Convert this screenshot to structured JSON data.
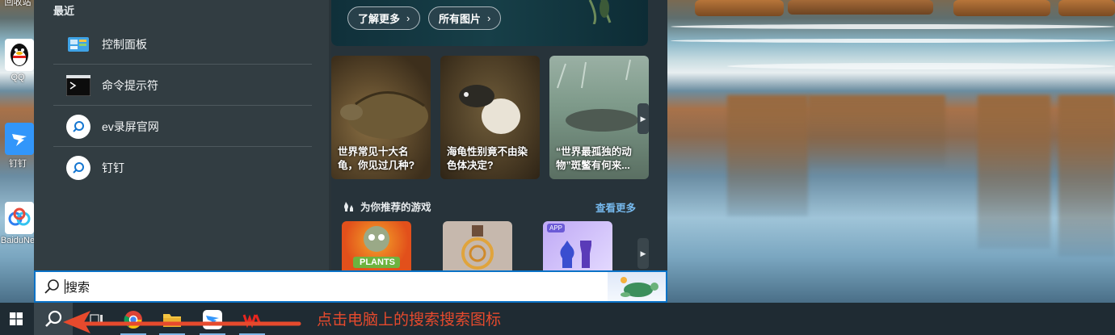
{
  "desktop": {
    "icons": [
      {
        "label": "回收站",
        "icon": "recycle-bin-icon"
      },
      {
        "label": "QQ",
        "icon": "qq-penguin-icon"
      },
      {
        "label": "钉钉",
        "icon": "dingtalk-icon"
      },
      {
        "label": "BaiduNe",
        "icon": "baidu-netdisk-icon"
      }
    ]
  },
  "start_menu": {
    "recent_title": "最近",
    "recent_items": [
      {
        "label": "控制面板",
        "icon": "control-panel-icon"
      },
      {
        "label": "命令提示符",
        "icon": "command-prompt-icon"
      },
      {
        "label": "ev录屏官网",
        "icon": "search-icon"
      },
      {
        "label": "钉钉",
        "icon": "search-icon"
      }
    ],
    "hero": {
      "learn_more": "了解更多",
      "all_images": "所有图片"
    },
    "news": [
      {
        "title": "世界常见十大名龟，你见过几种?"
      },
      {
        "title": "海龟性别竟不由染色体决定?"
      },
      {
        "title": "“世界最孤独的动物”斑鳖有何来..."
      }
    ],
    "games": {
      "header": "为你推荐的游戏",
      "more": "查看更多",
      "tiles": [
        {
          "name": "plants-vs-zombies",
          "text": "PLANTS"
        },
        {
          "name": "puzzle-game",
          "text": ""
        },
        {
          "name": "chess-game",
          "text": "APP"
        }
      ]
    }
  },
  "search": {
    "placeholder": "搜索"
  },
  "taskbar": {
    "apps": [
      "chrome-icon",
      "file-explorer-icon",
      "dingtalk-icon",
      "wps-icon"
    ],
    "annotation": "点击电脑上的搜索搜索图标"
  },
  "colors": {
    "accent": "#0a72c6",
    "annotation": "#e64a2d",
    "link": "#76b9ed"
  }
}
